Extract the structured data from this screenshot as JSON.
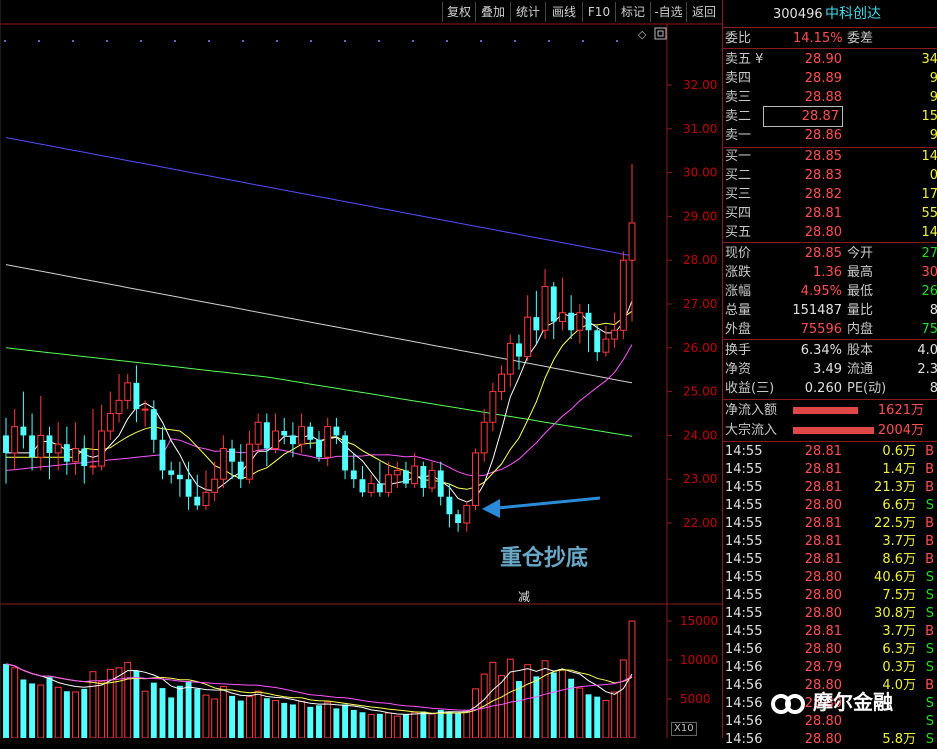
{
  "toolbar": {
    "buttons": [
      "复权",
      "叠加",
      "统计",
      "画线",
      "F10",
      "标记",
      "-自选",
      "返回"
    ]
  },
  "stock": {
    "code": "300496",
    "name": "中科创达"
  },
  "weibi": {
    "label": "委比",
    "value": "14.15%",
    "label2": "委差"
  },
  "asks": [
    {
      "label": "卖五 ¥",
      "price": "28.90",
      "vol": "34"
    },
    {
      "label": "卖四",
      "price": "28.89",
      "vol": "9"
    },
    {
      "label": "卖三",
      "price": "28.88",
      "vol": "9"
    },
    {
      "label": "卖二",
      "price": "28.87",
      "vol": "15"
    },
    {
      "label": "卖一",
      "price": "28.86",
      "vol": "9"
    }
  ],
  "bids": [
    {
      "label": "买一",
      "price": "28.85",
      "vol": "14"
    },
    {
      "label": "买二",
      "price": "28.83",
      "vol": "0"
    },
    {
      "label": "买三",
      "price": "28.82",
      "vol": "17"
    },
    {
      "label": "买四",
      "price": "28.81",
      "vol": "55"
    },
    {
      "label": "买五",
      "price": "28.80",
      "vol": "14"
    }
  ],
  "quote": [
    {
      "l1": "现价",
      "v1": "28.85",
      "c1": "red",
      "l2": "今开",
      "v2": "27",
      "c2": "grn"
    },
    {
      "l1": "涨跌",
      "v1": "1.36",
      "c1": "red",
      "l2": "最高",
      "v2": "30",
      "c2": "red"
    },
    {
      "l1": "涨幅",
      "v1": "4.95%",
      "c1": "red",
      "l2": "最低",
      "v2": "26",
      "c2": "grn"
    },
    {
      "l1": "总量",
      "v1": "151487",
      "c1": "wht",
      "l2": "量比",
      "v2": "8",
      "c2": "wht"
    },
    {
      "l1": "外盘",
      "v1": "75596",
      "c1": "red",
      "l2": "内盘",
      "v2": "75",
      "c2": "grn"
    }
  ],
  "fund": [
    {
      "l1": "换手",
      "v1": "6.34%",
      "l2": "股本",
      "v2": "4.0"
    },
    {
      "l1": "净资",
      "v1": "3.49",
      "l2": "流通",
      "v2": "2.3"
    },
    {
      "l1": "收益(三)",
      "v1": "0.260",
      "l2": "PE(动)",
      "v2": "8"
    }
  ],
  "flows": [
    {
      "label": "净流入额",
      "value": "1621万",
      "bar": 0.72
    },
    {
      "label": "大宗流入",
      "value": "2004万",
      "bar": 0.9
    }
  ],
  "ticks": [
    {
      "t": "14:55",
      "p": "28.81",
      "v": "0.6万",
      "d": "B"
    },
    {
      "t": "14:55",
      "p": "28.81",
      "v": "1.4万",
      "d": "B"
    },
    {
      "t": "14:55",
      "p": "28.81",
      "v": "21.3万",
      "d": "B"
    },
    {
      "t": "14:55",
      "p": "28.80",
      "v": "6.6万",
      "d": "S"
    },
    {
      "t": "14:55",
      "p": "28.81",
      "v": "22.5万",
      "d": "B"
    },
    {
      "t": "14:55",
      "p": "28.81",
      "v": "3.7万",
      "d": "B"
    },
    {
      "t": "14:55",
      "p": "28.81",
      "v": "8.6万",
      "d": "B"
    },
    {
      "t": "14:55",
      "p": "28.80",
      "v": "40.6万",
      "d": "S"
    },
    {
      "t": "14:55",
      "p": "28.80",
      "v": "7.5万",
      "d": "S"
    },
    {
      "t": "14:55",
      "p": "28.80",
      "v": "30.8万",
      "d": "S"
    },
    {
      "t": "14:55",
      "p": "28.81",
      "v": "3.7万",
      "d": "B"
    },
    {
      "t": "14:56",
      "p": "28.80",
      "v": "6.3万",
      "d": "S"
    },
    {
      "t": "14:56",
      "p": "28.79",
      "v": "0.3万",
      "d": "S"
    },
    {
      "t": "14:56",
      "p": "28.80",
      "v": "4.0万",
      "d": "B"
    },
    {
      "t": "14:56",
      "p": "28.80",
      "v": "",
      "d": "S"
    },
    {
      "t": "14:56",
      "p": "28.80",
      "v": "",
      "d": "S"
    },
    {
      "t": "14:56",
      "p": "28.80",
      "v": "5.8万",
      "d": "S"
    }
  ],
  "price_axis": [
    "32.00",
    "31.00",
    "30.00",
    "29.00",
    "28.00",
    "27.00",
    "26.00",
    "25.00",
    "24.00",
    "23.00",
    "22.00"
  ],
  "vol_axis": [
    "15000",
    "10000",
    "5000"
  ],
  "annotation": "重仓抄底",
  "minus_label": "减",
  "x10_label": "X10",
  "logo_text": "摩尔金融",
  "colors": {
    "up": "#ff3a3a",
    "down": "#54ffff",
    "ma5": "#ffffff",
    "ma10": "#ffff54",
    "ma20": "#ff54ff",
    "ma60": "#54ff54",
    "ma120": "#d0d0d0",
    "ma250": "#5050ff"
  }
}
